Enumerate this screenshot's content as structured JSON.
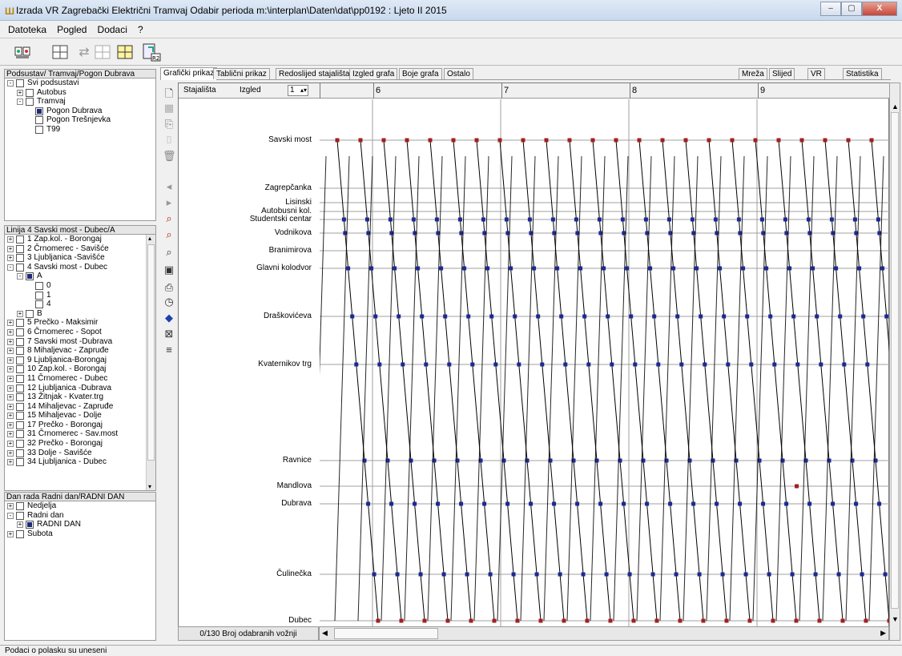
{
  "window": {
    "title": "Izrada VR  Zagrebački Električni Tramvaj Odabir perioda m:\\interplan\\Daten\\dat\\pp0192 : Ljeto II 2015",
    "min_label": "–",
    "max_label": "▢",
    "close_label": "X"
  },
  "menu": [
    "Datoteka",
    "Pogled",
    "Dodaci",
    "?"
  ],
  "toolbar": {
    "icons": [
      "app-icon",
      "grid-expand-icon",
      "double-arrow-icon",
      "grid-icon",
      "grid-yellow-icon",
      "book-route-icon"
    ],
    "badge": "R2"
  },
  "panels": {
    "subsystems": {
      "title": "Podsustav/  Tramvaj/Pogon Dubrava",
      "rows": [
        {
          "label": "Svi podsustavi",
          "indent": 0,
          "exp": "-",
          "checked": false
        },
        {
          "label": "Autobus",
          "indent": 1,
          "exp": "+",
          "checked": false
        },
        {
          "label": "Tramvaj",
          "indent": 1,
          "exp": "-",
          "checked": false
        },
        {
          "label": "Pogon Dubrava",
          "indent": 2,
          "exp": "",
          "checked": true,
          "selected": true
        },
        {
          "label": "Pogon Trešnjevka",
          "indent": 2,
          "exp": "",
          "checked": false
        },
        {
          "label": "T99",
          "indent": 2,
          "exp": "",
          "checked": false
        }
      ]
    },
    "lines": {
      "title": "Linija  4 Savski most - Dubec/A",
      "rows": [
        {
          "label": "1 Zap.kol. - Borongaj",
          "indent": 0,
          "exp": "+",
          "checked": false
        },
        {
          "label": "2 Črnomerec - Savišće",
          "indent": 0,
          "exp": "+",
          "checked": false
        },
        {
          "label": "3 Ljubljanica -Savišće",
          "indent": 0,
          "exp": "+",
          "checked": false
        },
        {
          "label": "4 Savski most - Dubec",
          "indent": 0,
          "exp": "-",
          "checked": false
        },
        {
          "label": "A",
          "indent": 1,
          "exp": "-",
          "checked": true
        },
        {
          "label": "0",
          "indent": 2,
          "exp": "",
          "checked": false
        },
        {
          "label": "1",
          "indent": 2,
          "exp": "",
          "checked": false
        },
        {
          "label": "4",
          "indent": 2,
          "exp": "",
          "checked": false
        },
        {
          "label": "B",
          "indent": 1,
          "exp": "+",
          "checked": false
        },
        {
          "label": "5 Prečko - Maksimir",
          "indent": 0,
          "exp": "+",
          "checked": false
        },
        {
          "label": "6 Črnomerec - Sopot",
          "indent": 0,
          "exp": "+",
          "checked": false
        },
        {
          "label": "7 Savski most -Dubrava",
          "indent": 0,
          "exp": "+",
          "checked": false
        },
        {
          "label": "8 Mihaljevac - Zapruđe",
          "indent": 0,
          "exp": "+",
          "checked": false
        },
        {
          "label": "9 Ljubljanica-Borongaj",
          "indent": 0,
          "exp": "+",
          "checked": false
        },
        {
          "label": "10 Zap.kol. - Borongaj",
          "indent": 0,
          "exp": "+",
          "checked": false
        },
        {
          "label": "11 Črnomerec - Dubec",
          "indent": 0,
          "exp": "+",
          "checked": false
        },
        {
          "label": "12 Ljubljanica -Dubrava",
          "indent": 0,
          "exp": "+",
          "checked": false
        },
        {
          "label": "13 Žitnjak - Kvater.trg",
          "indent": 0,
          "exp": "+",
          "checked": false
        },
        {
          "label": "14 Mihaljevac - Zapruđe",
          "indent": 0,
          "exp": "+",
          "checked": false
        },
        {
          "label": "15 Mihaljevac - Dolje",
          "indent": 0,
          "exp": "+",
          "checked": false
        },
        {
          "label": "17 Prečko - Borongaj",
          "indent": 0,
          "exp": "+",
          "checked": false
        },
        {
          "label": "31 Črnomerec - Sav.most",
          "indent": 0,
          "exp": "+",
          "checked": false
        },
        {
          "label": "32 Prečko - Borongaj",
          "indent": 0,
          "exp": "+",
          "checked": false
        },
        {
          "label": "33 Dolje - Savišće",
          "indent": 0,
          "exp": "+",
          "checked": false
        },
        {
          "label": "34 Ljubljanica - Dubec",
          "indent": 0,
          "exp": "+",
          "checked": false
        }
      ]
    },
    "day": {
      "title": "Dan rada  Radni dan/RADNI DAN",
      "rows": [
        {
          "label": "Nedjelja",
          "indent": 0,
          "exp": "+",
          "checked": false
        },
        {
          "label": "Radni dan",
          "indent": 0,
          "exp": "-",
          "checked": false
        },
        {
          "label": "RADNI DAN",
          "indent": 1,
          "exp": "+",
          "checked": true
        },
        {
          "label": "Subota",
          "indent": 0,
          "exp": "+",
          "checked": false
        }
      ]
    }
  },
  "tabs": {
    "left": [
      "Grafički prikaz",
      "Tablični prikaz",
      "Redoslijed stajališta",
      "Izgled grafa",
      "Boje grafa",
      "Ostalo"
    ],
    "right": [
      "Mreža",
      "Slijed",
      "VR",
      "Statistika"
    ],
    "active": "Grafički prikaz"
  },
  "side_icons": [
    "new-doc-icon",
    "grid-add-icon",
    "copy-icon",
    "bracket-icon",
    "trash-icon",
    "arrow-left-icon",
    "arrow-right-icon",
    "magnifier-red-icon",
    "magnifier-multi-icon",
    "magnifier-icon",
    "save-icon",
    "print-icon",
    "clock-icon",
    "tag-icon",
    "cross-pattern-icon",
    "bus-stops-icon"
  ],
  "chart_header": {
    "stops_label": "Stajališta",
    "view_label": "Izgled",
    "view_value": "1",
    "hours": [
      "6",
      "7",
      "8",
      "9"
    ]
  },
  "stops": [
    "Savski most",
    "Zagrepčanka",
    "Lisinski",
    "Autobusni kol.",
    "Studentski centar",
    "Vodnikova",
    "Branimirova",
    "Glavni kolodvor",
    "Draškovićeva",
    "Kvaternikov trg",
    "Ravnice",
    "Mandlova",
    "Dubrava",
    "Čulinečka",
    "Dubec"
  ],
  "colors": {
    "terminal_marker": "#a22020",
    "stop_marker": "#1c2a90",
    "trip_line": "#000000",
    "grid_line": "#a0a0a0"
  },
  "bottom": {
    "selected_count": "0/130  Broj odabranih vožnji"
  },
  "status": "Podaci o polasku su uneseni"
}
